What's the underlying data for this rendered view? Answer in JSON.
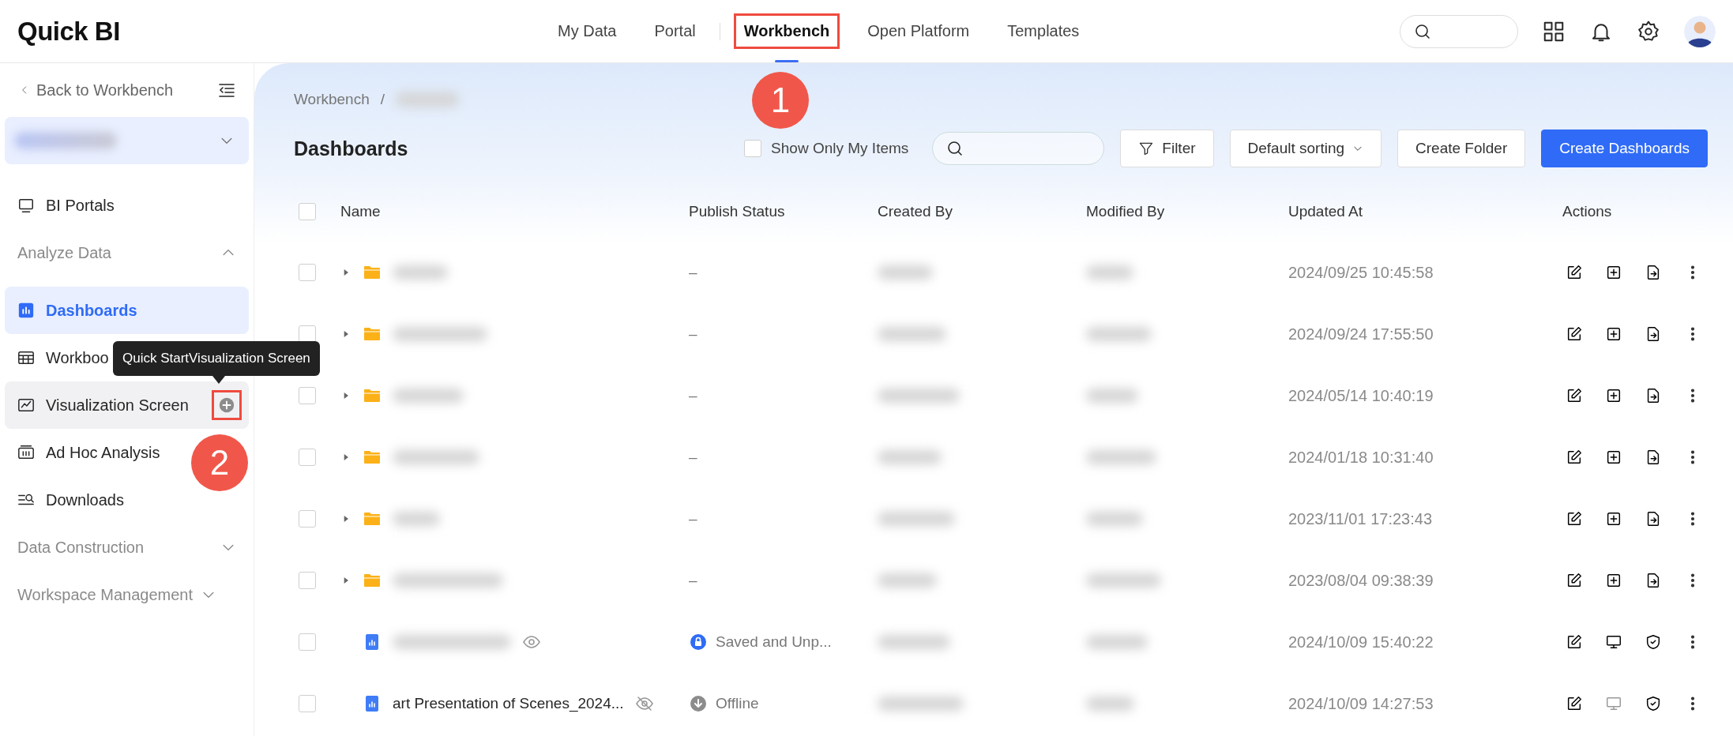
{
  "logo": {
    "text": "Quick BI"
  },
  "nav": [
    {
      "label": "My Data",
      "selected": false,
      "highlighted": false
    },
    {
      "label": "Portal",
      "selected": false,
      "highlighted": false
    },
    {
      "label": "Workbench",
      "selected": true,
      "highlighted": true
    },
    {
      "label": "Open Platform",
      "selected": false,
      "highlighted": false
    },
    {
      "label": "Templates",
      "selected": false,
      "highlighted": false
    }
  ],
  "sidebar": {
    "back": "Back to Workbench",
    "items": [
      {
        "kind": "item",
        "label": "BI Portals",
        "selected": false,
        "hovered": false
      },
      {
        "kind": "group",
        "label": "Analyze Data",
        "expanded": true
      },
      {
        "kind": "item",
        "label": "Dashboards",
        "selected": true,
        "hovered": false
      },
      {
        "kind": "item",
        "label": "Workboo",
        "selected": false,
        "hovered": false
      },
      {
        "kind": "item",
        "label": "Visualization Screen",
        "selected": false,
        "hovered": true,
        "add": {
          "highlighted": true
        }
      },
      {
        "kind": "item",
        "label": "Ad Hoc Analysis",
        "selected": false,
        "hovered": false
      },
      {
        "kind": "item",
        "label": "Downloads",
        "selected": false,
        "hovered": false
      },
      {
        "kind": "group",
        "label": "Data Construction",
        "expanded": false
      },
      {
        "kind": "group",
        "label": "Workspace Management",
        "expanded": false
      }
    ]
  },
  "tooltip": {
    "text": "Quick StartVisualization Screen"
  },
  "breadcrumb": {
    "link": "Workbench",
    "separator": "/"
  },
  "page_title": "Dashboards",
  "toolbar": {
    "only_mine": {
      "label": "Show Only My Items",
      "checked": false
    },
    "filter": "Filter",
    "sorting": "Default sorting",
    "create_folder": "Create Folder",
    "create": "Create Dashboards"
  },
  "table": {
    "select_all": {
      "checked": false
    },
    "columns": [
      "Name",
      "Publish Status",
      "Created By",
      "Modified By",
      "Updated At",
      "Actions"
    ],
    "rows": [
      {
        "kind": "folder",
        "checked": false,
        "name": {
          "blurred": true
        },
        "status": {
          "kind": "none",
          "text": "–"
        },
        "updated": "2024/09/25 10:45:58",
        "actions": [
          {
            "kind": "edit",
            "disabled": false
          },
          {
            "kind": "add",
            "disabled": false
          },
          {
            "kind": "move",
            "disabled": false
          },
          {
            "kind": "more",
            "disabled": false
          }
        ]
      },
      {
        "kind": "folder",
        "checked": false,
        "name": {
          "blurred": true
        },
        "status": {
          "kind": "none",
          "text": "–"
        },
        "updated": "2024/09/24 17:55:50",
        "actions": [
          {
            "kind": "edit",
            "disabled": false
          },
          {
            "kind": "add",
            "disabled": false
          },
          {
            "kind": "move",
            "disabled": false
          },
          {
            "kind": "more",
            "disabled": false
          }
        ]
      },
      {
        "kind": "folder",
        "checked": false,
        "name": {
          "blurred": true
        },
        "status": {
          "kind": "none",
          "text": "–"
        },
        "updated": "2024/05/14 10:40:19",
        "actions": [
          {
            "kind": "edit",
            "disabled": false
          },
          {
            "kind": "add",
            "disabled": false
          },
          {
            "kind": "move",
            "disabled": false
          },
          {
            "kind": "more",
            "disabled": false
          }
        ]
      },
      {
        "kind": "folder",
        "checked": false,
        "name": {
          "blurred": true
        },
        "status": {
          "kind": "none",
          "text": "–"
        },
        "updated": "2024/01/18 10:31:40",
        "actions": [
          {
            "kind": "edit",
            "disabled": false
          },
          {
            "kind": "add",
            "disabled": false
          },
          {
            "kind": "move",
            "disabled": false
          },
          {
            "kind": "more",
            "disabled": false
          }
        ]
      },
      {
        "kind": "folder",
        "checked": false,
        "name": {
          "blurred": true
        },
        "status": {
          "kind": "none",
          "text": "–"
        },
        "updated": "2023/11/01 17:23:43",
        "actions": [
          {
            "kind": "edit",
            "disabled": false
          },
          {
            "kind": "add",
            "disabled": false
          },
          {
            "kind": "move",
            "disabled": false
          },
          {
            "kind": "more",
            "disabled": false
          }
        ]
      },
      {
        "kind": "folder",
        "checked": false,
        "name": {
          "blurred": true
        },
        "status": {
          "kind": "none",
          "text": "–"
        },
        "updated": "2023/08/04 09:38:39",
        "actions": [
          {
            "kind": "edit",
            "disabled": false
          },
          {
            "kind": "add",
            "disabled": false
          },
          {
            "kind": "move",
            "disabled": false
          },
          {
            "kind": "more",
            "disabled": false
          }
        ]
      },
      {
        "kind": "dashboard",
        "checked": false,
        "name": {
          "blurred": true,
          "hidden": false
        },
        "status": {
          "kind": "saved",
          "text": "Saved and Unp..."
        },
        "updated": "2024/10/09 15:40:22",
        "actions": [
          {
            "kind": "edit",
            "disabled": false
          },
          {
            "kind": "present",
            "disabled": false
          },
          {
            "kind": "permission",
            "disabled": false
          },
          {
            "kind": "more",
            "disabled": false
          }
        ]
      },
      {
        "kind": "dashboard",
        "checked": false,
        "name": {
          "blurred": false,
          "text": "art Presentation of Scenes_2024...",
          "hidden": true
        },
        "status": {
          "kind": "offline",
          "text": "Offline"
        },
        "updated": "2024/10/09 14:27:53",
        "actions": [
          {
            "kind": "edit",
            "disabled": false
          },
          {
            "kind": "present",
            "disabled": true
          },
          {
            "kind": "permission",
            "disabled": false
          },
          {
            "kind": "more",
            "disabled": false
          }
        ]
      }
    ]
  },
  "annotations": [
    {
      "kind": "marker",
      "label": "1"
    },
    {
      "kind": "marker",
      "label": "2"
    }
  ]
}
